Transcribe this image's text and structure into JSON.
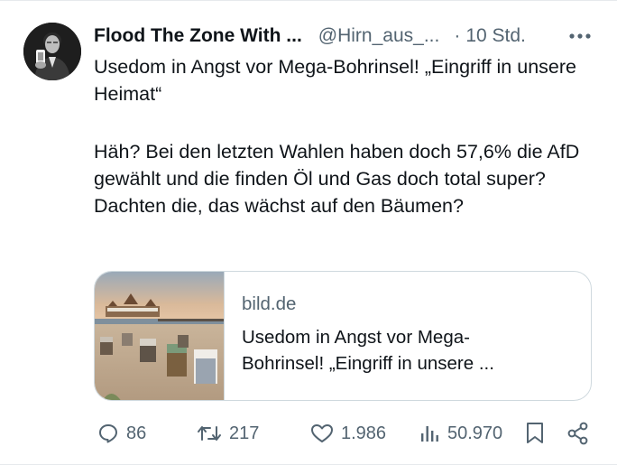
{
  "colors": {
    "text": "#0f1419",
    "secondary": "#536471",
    "border": "#cfd9de"
  },
  "tweet": {
    "display_name": "Flood The Zone With ...",
    "handle": "@Hirn_aus_...",
    "separator": "·",
    "time": "10 Std.",
    "more_icon": "more-horizontal-icon",
    "text_lines": [
      "Usedom in Angst vor Mega-Bohrinsel! „Eingriff in unsere Heimat“",
      "Häh? Bei den letzten Wahlen haben doch 57,6% die AfD gewählt und die finden Öl und Gas doch total super?",
      "Dachten die, das wächst auf den Bäumen?"
    ]
  },
  "link_card": {
    "domain": "bild.de",
    "title_line1": "Usedom in Angst vor Mega-",
    "title_line2": "Bohrinsel! „Eingriff in unsere ..."
  },
  "actions": {
    "replies": "86",
    "reposts": "217",
    "likes": "1.986",
    "views": "50.970",
    "icons": [
      "reply-icon",
      "repost-icon",
      "like-icon",
      "views-icon",
      "bookmark-icon",
      "share-icon"
    ]
  }
}
